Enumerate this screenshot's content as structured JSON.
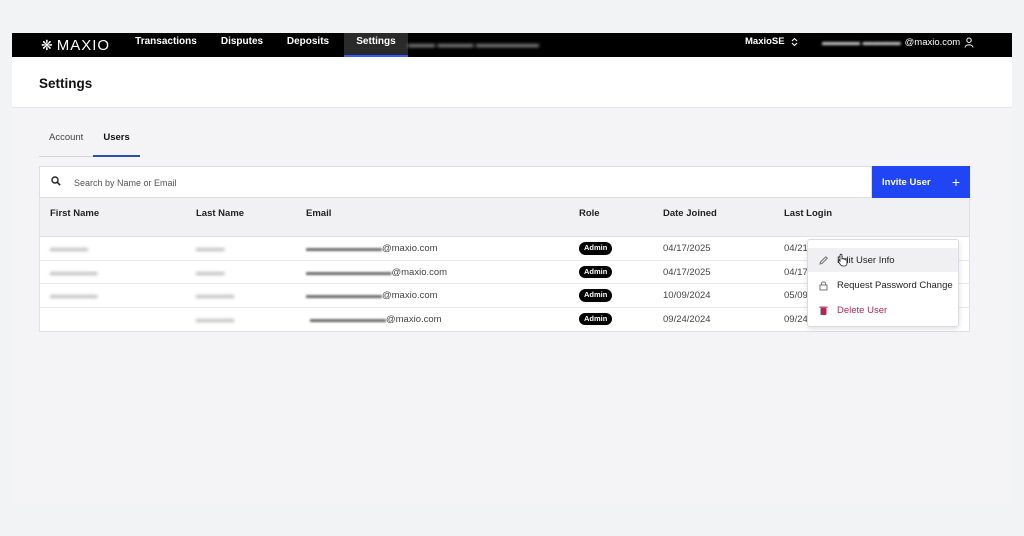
{
  "brand": {
    "name": "MAXIO",
    "logo_icon": "snowflake-logo-icon"
  },
  "nav": {
    "items": [
      {
        "label": "Transactions",
        "active": false
      },
      {
        "label": "Disputes",
        "active": false
      },
      {
        "label": "Deposits",
        "active": false
      },
      {
        "label": "Settings",
        "active": true
      }
    ],
    "org_label": "MaxioSE",
    "account_email_domain": "@maxio.com"
  },
  "page": {
    "title": "Settings"
  },
  "tabs": [
    {
      "label": "Account",
      "active": false
    },
    {
      "label": "Users",
      "active": true
    }
  ],
  "search": {
    "placeholder": "Search by Name or Email",
    "value": ""
  },
  "invite_button": {
    "label": "Invite User",
    "icon": "plus-icon"
  },
  "table": {
    "headers": [
      "First Name",
      "Last Name",
      "Email",
      "Role",
      "Date Joined",
      "Last Login"
    ],
    "rows": [
      {
        "email": "@maxio.com",
        "role": "Admin",
        "date_joined": "04/17/2025",
        "last_login": "04/21"
      },
      {
        "email": "@maxio.com",
        "role": "Admin",
        "date_joined": "04/17/2025",
        "last_login": "04/17"
      },
      {
        "email": "@maxio.com",
        "role": "Admin",
        "date_joined": "10/09/2024",
        "last_login": "05/09"
      },
      {
        "email": "@maxio.com",
        "role": "Admin",
        "date_joined": "09/24/2024",
        "last_login": "09/24"
      }
    ]
  },
  "context_menu": {
    "items": [
      {
        "label": "Edit User Info",
        "icon": "pencil-icon"
      },
      {
        "label": "Request Password Change",
        "icon": "lock-icon"
      },
      {
        "label": "Delete User",
        "icon": "trash-icon"
      }
    ]
  },
  "colors": {
    "accent": "#1f45f5",
    "nav_bg": "#000000",
    "danger": "#b0295a",
    "badge_bg": "#000000"
  }
}
